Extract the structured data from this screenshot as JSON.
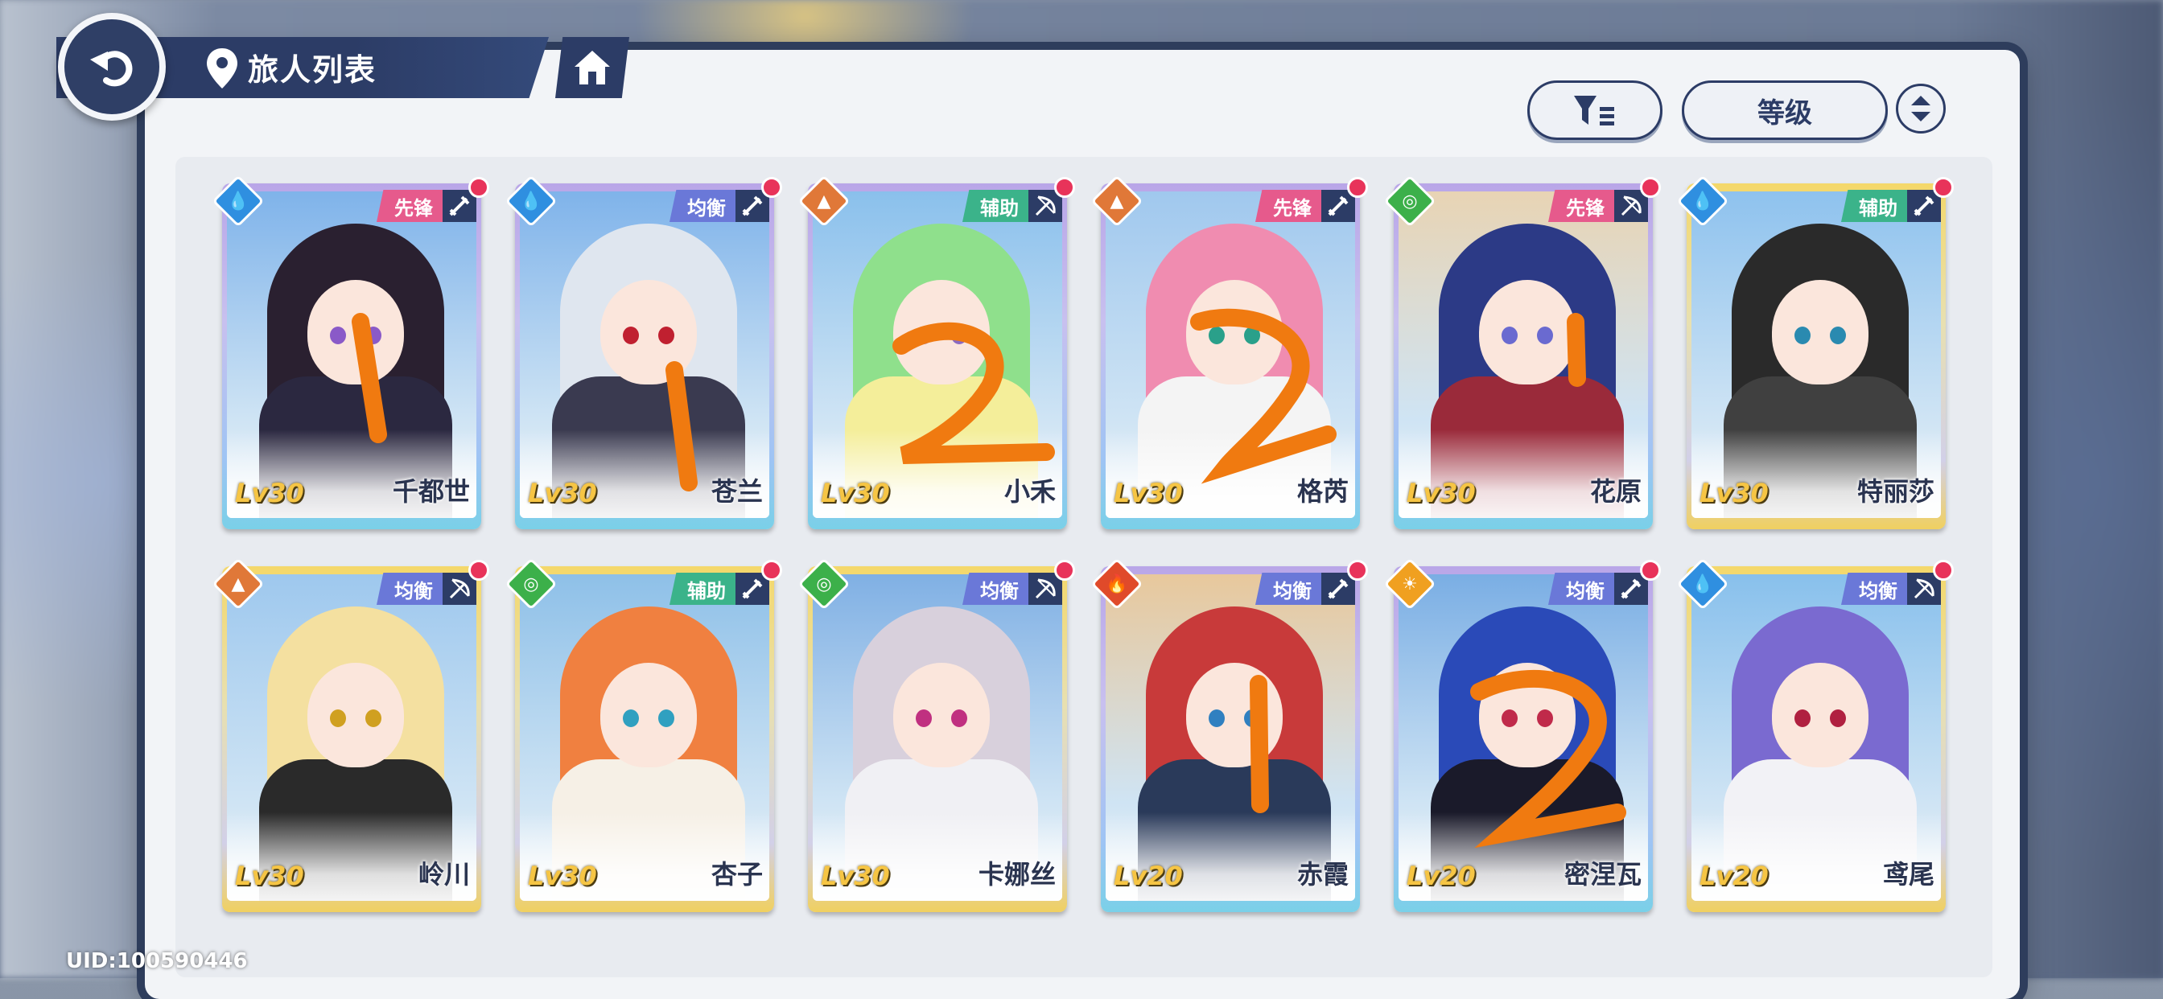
{
  "header": {
    "title": "旅人列表",
    "icons": [
      "back-arrow-icon",
      "location-pin-icon",
      "home-icon"
    ]
  },
  "toolbar": {
    "filter_icon": "filter-icon",
    "sort_label": "等级",
    "order_icon": "sort-order-icon"
  },
  "footer": {
    "uid": "UID:100590446"
  },
  "colors": {
    "navy": "#2c3c66",
    "panel": "#f2f4f7",
    "level_gold": "#f6c544",
    "role_vanguard": "#e65a8c",
    "role_balance": "#6a78d8",
    "role_support": "#3bb38a",
    "notify_dot": "#e8335a",
    "annotation_orange": "#f07a10"
  },
  "cards": [
    {
      "name": "千都世",
      "level": "Lv30",
      "role": "先锋",
      "role_kind": "vanguard",
      "weapon": "sword-icon",
      "element": "water",
      "frame": "purple",
      "hair": "#2a2030",
      "outfit": "#2b2840",
      "eye": "#8a5ac8",
      "sky": "#7fb3ea"
    },
    {
      "name": "苍兰",
      "level": "Lv30",
      "role": "均衡",
      "role_kind": "balance",
      "weapon": "sword-icon",
      "element": "water",
      "frame": "purple",
      "hair": "#dfe6ef",
      "outfit": "#3a3a50",
      "eye": "#c02030",
      "sky": "#7fb3ea"
    },
    {
      "name": "小禾",
      "level": "Lv30",
      "role": "辅助",
      "role_kind": "support",
      "weapon": "bow-icon",
      "element": "earth",
      "frame": "purple",
      "hair": "#8fe08c",
      "outfit": "#f4ee9a",
      "eye": "#8a6ac0",
      "sky": "#8ac0ec"
    },
    {
      "name": "格芮",
      "level": "Lv30",
      "role": "先锋",
      "role_kind": "vanguard",
      "weapon": "sword-icon",
      "element": "earth",
      "frame": "purple",
      "hair": "#f08cb0",
      "outfit": "#f4f4f4",
      "eye": "#2aa08a",
      "sky": "#a0c8ee"
    },
    {
      "name": "花原",
      "level": "Lv30",
      "role": "先锋",
      "role_kind": "vanguard",
      "weapon": "bow-icon",
      "element": "wind",
      "frame": "purple",
      "hair": "#2c3a86",
      "outfit": "#9a2a3a",
      "eye": "#6a6ad0",
      "sky": "#e8d4b4"
    },
    {
      "name": "特丽莎",
      "level": "Lv30",
      "role": "辅助",
      "role_kind": "support",
      "weapon": "sword-icon",
      "element": "water",
      "frame": "gold",
      "hair": "#2a2a2a",
      "outfit": "#404040",
      "eye": "#2a8ab0",
      "sky": "#8ec2ee"
    },
    {
      "name": "岭川",
      "level": "Lv30",
      "role": "均衡",
      "role_kind": "balance",
      "weapon": "bow-icon",
      "element": "earth",
      "frame": "gold",
      "hair": "#f4e0a0",
      "outfit": "#2a2a2a",
      "eye": "#d0a020",
      "sky": "#9ec8ee"
    },
    {
      "name": "杏子",
      "level": "Lv30",
      "role": "辅助",
      "role_kind": "support",
      "weapon": "sword-icon",
      "element": "wind",
      "frame": "gold",
      "hair": "#f08040",
      "outfit": "#f6f0e6",
      "eye": "#30a0c0",
      "sky": "#8ec0e8"
    },
    {
      "name": "卡娜丝",
      "level": "Lv30",
      "role": "均衡",
      "role_kind": "balance",
      "weapon": "bow-icon",
      "element": "wind",
      "frame": "gold",
      "hair": "#d8d0dc",
      "outfit": "#f0f0f4",
      "eye": "#c03080",
      "sky": "#80b0e4"
    },
    {
      "name": "赤霞",
      "level": "Lv20",
      "role": "均衡",
      "role_kind": "balance",
      "weapon": "sword-icon",
      "element": "fire",
      "frame": "purple",
      "hair": "#c83a3a",
      "outfit": "#2a3a5a",
      "eye": "#3080c0",
      "sky": "#e8c89c"
    },
    {
      "name": "密涅瓦",
      "level": "Lv20",
      "role": "均衡",
      "role_kind": "balance",
      "weapon": "sword-icon",
      "element": "light",
      "frame": "purple",
      "hair": "#2a4ab8",
      "outfit": "#1a1a2a",
      "eye": "#c02a4a",
      "sky": "#7aaee4"
    },
    {
      "name": "鸢尾",
      "level": "Lv20",
      "role": "均衡",
      "role_kind": "balance",
      "weapon": "bow-icon",
      "element": "water",
      "frame": "gold",
      "hair": "#7a6ad0",
      "outfit": "#f2f2f6",
      "eye": "#b02040",
      "sky": "#88c0ec"
    }
  ]
}
